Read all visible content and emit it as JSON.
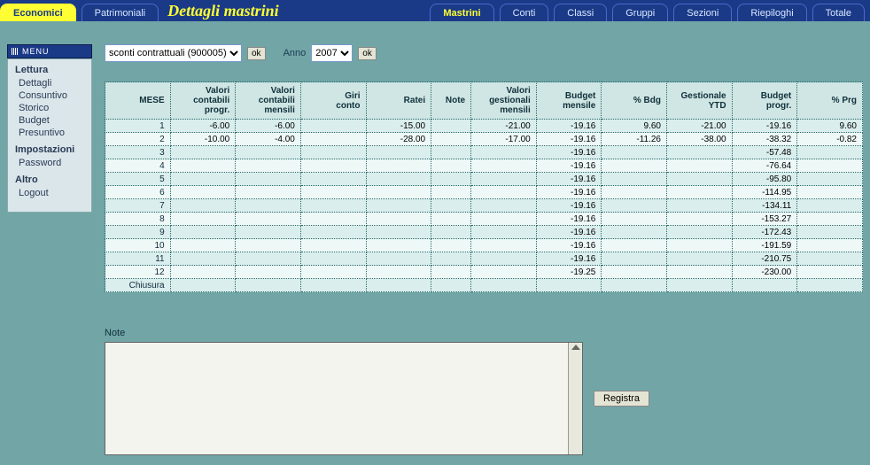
{
  "tabs": {
    "left": [
      "Economici",
      "Patrimoniali"
    ],
    "title": "Dettagli mastrini",
    "right": [
      "Mastrini",
      "Conti",
      "Classi",
      "Gruppi",
      "Sezioni",
      "Riepiloghi",
      "Totale"
    ],
    "active_left": "Economici",
    "active_right": "Mastrini"
  },
  "sidebar": {
    "menu_label": "MENU",
    "sections": [
      {
        "head": "Lettura",
        "items": [
          "Dettagli",
          "Consuntivo",
          "Storico",
          "Budget",
          "Presuntivo"
        ]
      },
      {
        "head": "Impostazioni",
        "items": [
          "Password"
        ]
      },
      {
        "head": "Altro",
        "items": [
          "Logout"
        ]
      }
    ]
  },
  "controls": {
    "select_value": "sconti contrattuali (900005)",
    "ok": "ok",
    "anno_label": "Anno",
    "year": "2007"
  },
  "table": {
    "headers": [
      "MESE",
      "Valori\ncontabili\nprogr.",
      "Valori\ncontabili\nmensili",
      "Giri\nconto",
      "Ratei",
      "Note",
      "Valori\ngestionali\nmensili",
      "Budget\nmensile",
      "% Bdg",
      "Gestionale\nYTD",
      "Budget\nprogr.",
      "% Prg"
    ],
    "rows": [
      {
        "mese": "1",
        "cells": [
          "-6.00",
          "-6.00",
          "",
          "-15.00",
          "",
          "-21.00",
          "-19.16",
          "9.60",
          "-21.00",
          "-19.16",
          "9.60"
        ]
      },
      {
        "mese": "2",
        "cells": [
          "-10.00",
          "-4.00",
          "",
          "-28.00",
          "",
          "-17.00",
          "-19.16",
          "-11.26",
          "-38.00",
          "-38.32",
          "-0.82"
        ]
      },
      {
        "mese": "3",
        "cells": [
          "",
          "",
          "",
          "",
          "",
          "",
          "-19.16",
          "",
          "",
          "-57.48",
          ""
        ]
      },
      {
        "mese": "4",
        "cells": [
          "",
          "",
          "",
          "",
          "",
          "",
          "-19.16",
          "",
          "",
          "-76.64",
          ""
        ]
      },
      {
        "mese": "5",
        "cells": [
          "",
          "",
          "",
          "",
          "",
          "",
          "-19.16",
          "",
          "",
          "-95.80",
          ""
        ]
      },
      {
        "mese": "6",
        "cells": [
          "",
          "",
          "",
          "",
          "",
          "",
          "-19.16",
          "",
          "",
          "-114.95",
          ""
        ]
      },
      {
        "mese": "7",
        "cells": [
          "",
          "",
          "",
          "",
          "",
          "",
          "-19.16",
          "",
          "",
          "-134.11",
          ""
        ]
      },
      {
        "mese": "8",
        "cells": [
          "",
          "",
          "",
          "",
          "",
          "",
          "-19.16",
          "",
          "",
          "-153.27",
          ""
        ]
      },
      {
        "mese": "9",
        "cells": [
          "",
          "",
          "",
          "",
          "",
          "",
          "-19.16",
          "",
          "",
          "-172.43",
          ""
        ]
      },
      {
        "mese": "10",
        "cells": [
          "",
          "",
          "",
          "",
          "",
          "",
          "-19.16",
          "",
          "",
          "-191.59",
          ""
        ]
      },
      {
        "mese": "11",
        "cells": [
          "",
          "",
          "",
          "",
          "",
          "",
          "-19.16",
          "",
          "",
          "-210.75",
          ""
        ]
      },
      {
        "mese": "12",
        "cells": [
          "",
          "",
          "",
          "",
          "",
          "",
          "-19.25",
          "",
          "",
          "-230.00",
          ""
        ]
      },
      {
        "mese": "Chiusura",
        "cells": [
          "",
          "",
          "",
          "",
          "",
          "",
          "",
          "",
          "",
          "",
          ""
        ]
      }
    ]
  },
  "note": {
    "label": "Note",
    "button": "Registra"
  }
}
